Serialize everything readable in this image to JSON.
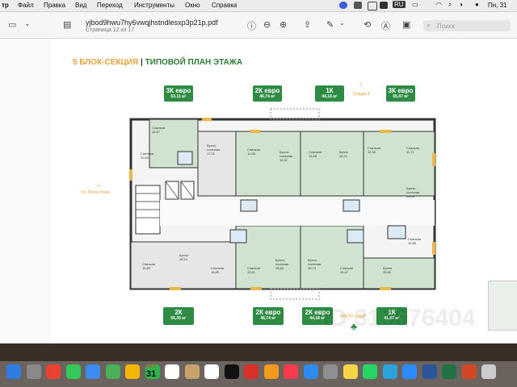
{
  "menubar": {
    "app": "тр",
    "items": [
      "Файл",
      "Правка",
      "Вид",
      "Переход",
      "Инструменты",
      "Окно",
      "Справка"
    ],
    "lang": "RU",
    "clock": "Пн, 31"
  },
  "toolbar": {
    "filename": "yjbod9hwu7hy6vwqjhstndlesxp3p21p.pdf",
    "page_info": "Страница 12 из 17",
    "search_placeholder": "Поиск"
  },
  "plan": {
    "heading_part1": "5 БЛОК-СЕКЦИЯ",
    "heading_sep": "|",
    "heading_part2": "ТИПОВОЙ ПЛАН ЭТАЖА",
    "nav_left": "Ул. Петра Нова",
    "nav_top": "Секция 4",
    "nav_bottom": "ВНУТР. ДВОР",
    "watermark": "ID 313676404",
    "badges_top": [
      {
        "type": "3К евро",
        "area": "63,11 м²"
      },
      {
        "type": "2К евро",
        "area": "46,74 м²"
      },
      {
        "type": "1К",
        "area": "44,18 м²"
      },
      {
        "type": "3К евро",
        "area": "65,47 м²"
      }
    ],
    "badges_bottom": [
      {
        "type": "2К",
        "area": "56,35 м²"
      },
      {
        "type": "2К евро",
        "area": "46,74 м²"
      },
      {
        "type": "2К евро",
        "area": "44,18 м²"
      },
      {
        "type": "1К",
        "area": "41,87 м²"
      }
    ],
    "rooms": [
      {
        "label": "Спальня",
        "area": "15,37"
      },
      {
        "label": "Спальня",
        "area": "11,59"
      },
      {
        "label": "Кухня-гостиная",
        "area": "17,21"
      },
      {
        "label": "Спальня",
        "area": "12,06"
      },
      {
        "label": "Кухня-гостиная",
        "area": "16,52"
      },
      {
        "label": "Спальня",
        "area": "14,68"
      },
      {
        "label": "Кухня",
        "area": "10,21"
      },
      {
        "label": "Спальня",
        "area": "12,06"
      },
      {
        "label": "Спальня",
        "area": "11,71"
      },
      {
        "label": "Кухня-гостиная",
        "area": "23,09"
      },
      {
        "label": "Спальня",
        "area": "15,89"
      },
      {
        "label": "Кухня",
        "area": "15,10"
      },
      {
        "label": "Спальня",
        "area": "16,85"
      },
      {
        "label": "Спальня",
        "area": "12,61"
      },
      {
        "label": "Кухня-гостиная",
        "area": "19,80"
      },
      {
        "label": "Кухня-гостиная",
        "area": "16,73"
      },
      {
        "label": "Спальня",
        "area": "15,47"
      },
      {
        "label": "Кухня",
        "area": "15,66"
      },
      {
        "label": "Спальня",
        "area": "10,65"
      }
    ]
  },
  "dock": {
    "calendar_month": "ОКТ",
    "calendar_day": "31",
    "icons": [
      "finder-icon",
      "launchpad-icon",
      "yandex-browser-icon",
      "messages-icon",
      "mail-icon",
      "maps-icon",
      "photos-icon",
      "facetime-icon",
      "calendar-icon",
      "contacts-icon",
      "reminders-icon",
      "tv-icon",
      "acrobat-icon",
      "pages-icon",
      "music-icon",
      "appstore-icon",
      "settings-icon",
      "notes-icon",
      "whatsapp-icon",
      "telegram-icon",
      "zoom-icon",
      "word-icon",
      "excel-icon",
      "powerpoint-icon",
      "preview-icon"
    ]
  }
}
